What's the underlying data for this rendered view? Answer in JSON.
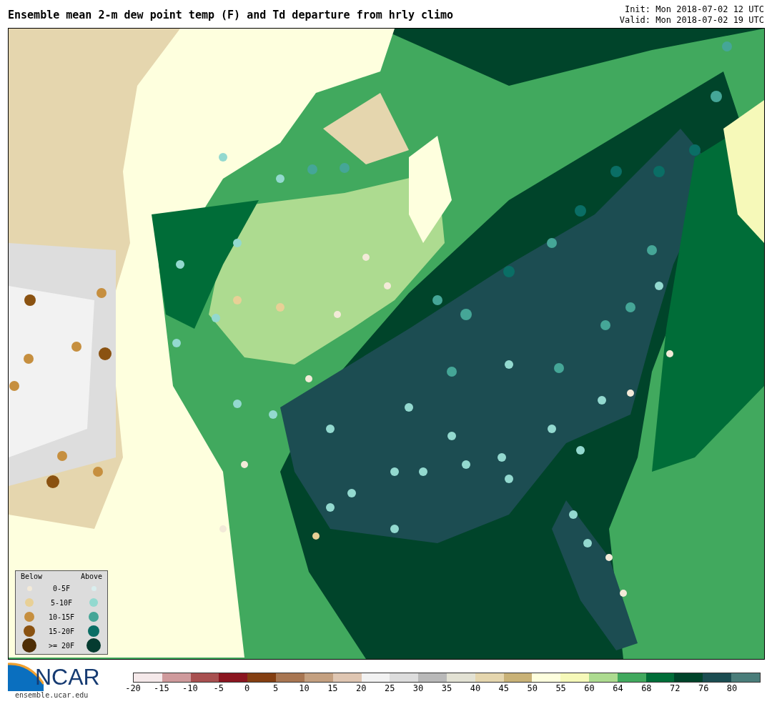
{
  "title": "Ensemble mean 2-m dew point temp (F) and Td departure from hrly climo",
  "init": "Init: Mon 2018-07-02 12 UTC",
  "valid": "Valid: Mon 2018-07-02 19 UTC",
  "legend": {
    "below_heading": "Below",
    "above_heading": "Above",
    "rows": [
      {
        "label": "0-5F",
        "below": {
          "color": "#f3ead8"
        },
        "above": {
          "color": "#d9eeee"
        }
      },
      {
        "label": "5-10F",
        "below": {
          "color": "#e8d096"
        },
        "above": {
          "color": "#93d9cf"
        }
      },
      {
        "label": "10-15F",
        "below": {
          "color": "#c68f3f"
        },
        "above": {
          "color": "#45a697"
        }
      },
      {
        "label": "15-20F",
        "below": {
          "color": "#8a5211"
        },
        "above": {
          "color": "#0a6e65"
        }
      },
      {
        "label": ">= 20F",
        "below": {
          "color": "#4e2e06"
        },
        "above": {
          "color": "#053b30"
        }
      }
    ]
  },
  "logo": {
    "text": "NCAR",
    "url": "ensemble.ucar.edu"
  },
  "colorbar": [
    {
      "tick": "-20",
      "color": "#f5e9ea"
    },
    {
      "tick": "-15",
      "color": "#cf9a9c"
    },
    {
      "tick": "-10",
      "color": "#a85050"
    },
    {
      "tick": "-5",
      "color": "#8b1620"
    },
    {
      "tick": "0",
      "color": "#843f12"
    },
    {
      "tick": "5",
      "color": "#a87652"
    },
    {
      "tick": "10",
      "color": "#c4a080"
    },
    {
      "tick": "15",
      "color": "#dfc6b2"
    },
    {
      "tick": "20",
      "color": "#f2f2f2"
    },
    {
      "tick": "25",
      "color": "#dddddd"
    },
    {
      "tick": "30",
      "color": "#b9b9b9"
    },
    {
      "tick": "35",
      "color": "#e3e2d4"
    },
    {
      "tick": "40",
      "color": "#e5d6ae"
    },
    {
      "tick": "45",
      "color": "#c9b277"
    },
    {
      "tick": "50",
      "color": "#feffde"
    },
    {
      "tick": "55",
      "color": "#f6f9b9"
    },
    {
      "tick": "60",
      "color": "#addb90"
    },
    {
      "tick": "64",
      "color": "#41a95e"
    },
    {
      "tick": "68",
      "color": "#006d38"
    },
    {
      "tick": "72",
      "color": "#00442a"
    },
    {
      "tick": "76",
      "color": "#1c4d52"
    },
    {
      "tick": "80",
      "color": "#4a7d7a"
    }
  ]
}
